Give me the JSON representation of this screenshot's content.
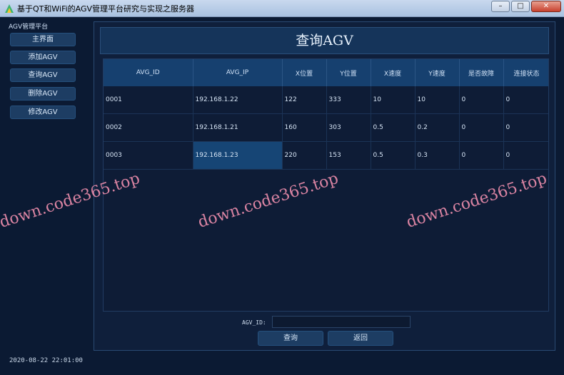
{
  "window": {
    "title": "基于QT和WiFi的AGV管理平台研究与实现之服务器",
    "minimize": "–",
    "maximize": "□",
    "close": "✕"
  },
  "sidebar": {
    "title": "AGV管理平台",
    "items": [
      {
        "label": "主界面"
      },
      {
        "label": "添加AGV"
      },
      {
        "label": "查询AGV"
      },
      {
        "label": "删除AGV"
      },
      {
        "label": "修改AGV"
      }
    ],
    "datetime": "2020-08-22 22:01:00"
  },
  "page": {
    "title": "查询AGV"
  },
  "table": {
    "columns": [
      "AVG_ID",
      "AVG_IP",
      "X位置",
      "Y位置",
      "X速度",
      "Y速度",
      "是否故障",
      "连接状态"
    ],
    "rows": [
      [
        "0001",
        "192.168.1.22",
        "122",
        "333",
        "10",
        "10",
        "0",
        "0"
      ],
      [
        "0002",
        "192.168.1.21",
        "160",
        "303",
        "0.5",
        "0.2",
        "0",
        "0"
      ],
      [
        "0003",
        "192.168.1.23",
        "220",
        "153",
        "0.5",
        "0.3",
        "0",
        "0"
      ]
    ]
  },
  "search": {
    "label": "AGV_ID:",
    "value": "",
    "query_label": "查询",
    "back_label": "返回"
  },
  "watermark": "down.code365.top",
  "colors": {
    "background": "#0b1a33",
    "header": "#16406f",
    "button": "#1d3d63",
    "watermark": "#f08fae"
  }
}
